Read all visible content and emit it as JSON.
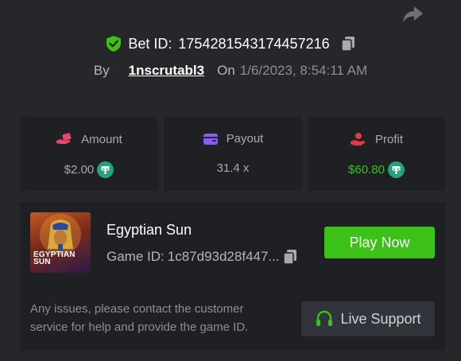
{
  "header": {
    "bet_id_label": "Bet ID:",
    "bet_id_value": "1754281543174457216",
    "by_label": "By",
    "username": "1nscrutabl3",
    "on_label": "On",
    "date": "1/6/2023, 8:54:11 AM"
  },
  "stats": {
    "amount": {
      "label": "Amount",
      "value": "$2.00",
      "icon": "hand-coin-icon"
    },
    "payout": {
      "label": "Payout",
      "value": "31.4 x",
      "icon": "wallet-icon"
    },
    "profit": {
      "label": "Profit",
      "value": "$60.80",
      "icon": "profit-hand-icon"
    }
  },
  "game": {
    "name": "Egyptian Sun",
    "id_label": "Game ID:",
    "id_value": "1c87d93d28f447...",
    "thumb_text": "EGYPTIAN SUN",
    "play_button": "Play Now"
  },
  "support": {
    "note": "Any issues, please contact the customer service for help and provide the game ID.",
    "button": "Live Support"
  },
  "colors": {
    "background": "#25272b",
    "panel": "#1e2023",
    "accent_green": "#3bc117",
    "tether": "#26a17b"
  }
}
